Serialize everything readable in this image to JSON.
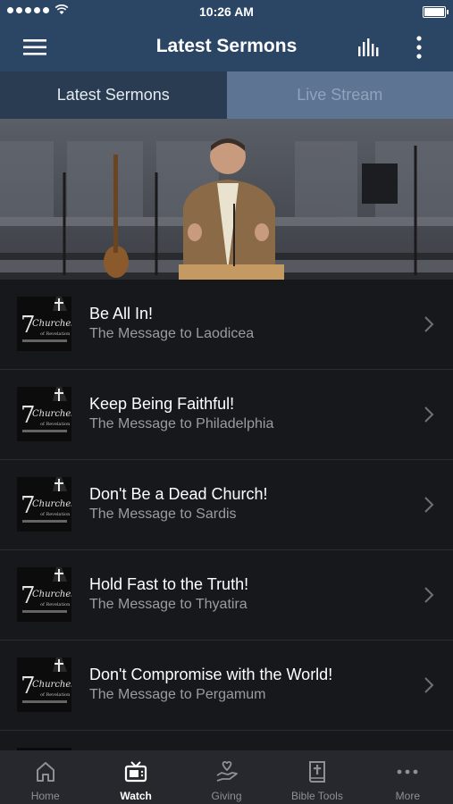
{
  "status": {
    "time": "10:26 AM"
  },
  "header": {
    "title": "Latest Sermons"
  },
  "tabs": [
    {
      "label": "Latest Sermons",
      "active": true
    },
    {
      "label": "Live Stream",
      "active": false
    }
  ],
  "sermons": [
    {
      "title": "Be All In!",
      "subtitle": "The Message to Laodicea"
    },
    {
      "title": "Keep Being Faithful!",
      "subtitle": "The Message to Philadelphia"
    },
    {
      "title": "Don't Be a Dead Church!",
      "subtitle": "The Message to Sardis"
    },
    {
      "title": "Hold Fast to the Truth!",
      "subtitle": "The Message to Thyatira"
    },
    {
      "title": "Don't Compromise with the World!",
      "subtitle": "The Message to Pergamum"
    }
  ],
  "thumbnail_art": {
    "number": "7",
    "word": "Churches",
    "tagline": "of Revelation"
  },
  "tabbar": [
    {
      "label": "Home",
      "icon": "home-icon"
    },
    {
      "label": "Watch",
      "icon": "tv-icon",
      "active": true
    },
    {
      "label": "Giving",
      "icon": "giving-hand-icon"
    },
    {
      "label": "Bible Tools",
      "icon": "bible-icon"
    },
    {
      "label": "More",
      "icon": "more-dots-icon"
    }
  ],
  "colors": {
    "navbar": "#2b4564",
    "tab_active": "#293c52",
    "tab_inactive": "#5d7592",
    "background": "#17181c",
    "tabbar": "#26282d"
  }
}
